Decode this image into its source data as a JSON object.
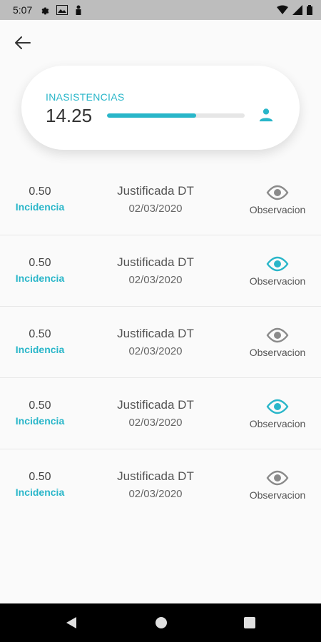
{
  "status_bar": {
    "time": "5:07"
  },
  "summary": {
    "label": "INASISTENCIAS",
    "value": "14.25",
    "progress_fraction": 0.65,
    "accent_color": "#29b6c9"
  },
  "records": [
    {
      "amount": "0.50",
      "type": "Incidencia",
      "status": "Justificada DT",
      "date": "02/03/2020",
      "action": "Observacion",
      "has_observation": false
    },
    {
      "amount": "0.50",
      "type": "Incidencia",
      "status": "Justificada DT",
      "date": "02/03/2020",
      "action": "Observacion",
      "has_observation": true
    },
    {
      "amount": "0.50",
      "type": "Incidencia",
      "status": "Justificada DT",
      "date": "02/03/2020",
      "action": "Observacion",
      "has_observation": false
    },
    {
      "amount": "0.50",
      "type": "Incidencia",
      "status": "Justificada DT",
      "date": "02/03/2020",
      "action": "Observacion",
      "has_observation": true
    },
    {
      "amount": "0.50",
      "type": "Incidencia",
      "status": "Justificada DT",
      "date": "02/03/2020",
      "action": "Observacion",
      "has_observation": false
    }
  ],
  "icons": {
    "back": "arrow-left-icon",
    "person": "person-icon",
    "observation": "eye-icon",
    "nav": [
      "back-triangle-icon",
      "home-circle-icon",
      "recents-square-icon"
    ]
  },
  "colors": {
    "accent": "#29b6c9",
    "eye_inactive": "#8a8a8a"
  }
}
